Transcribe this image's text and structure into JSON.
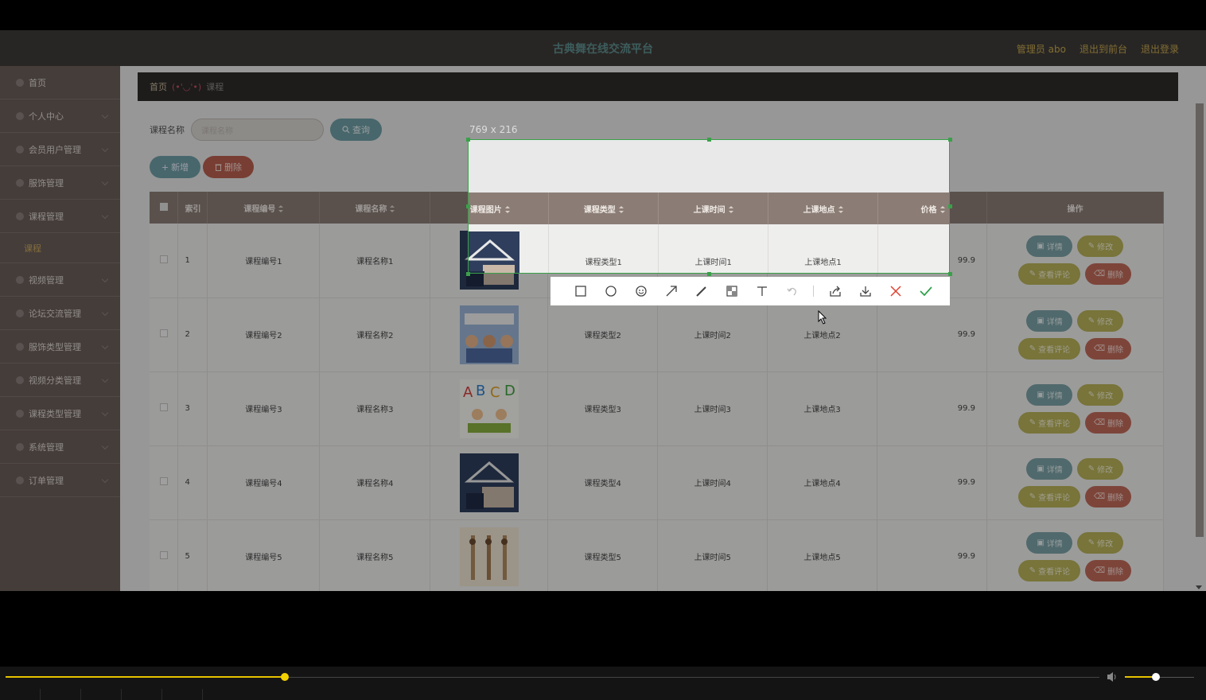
{
  "header": {
    "title": "古典舞在线交流平台",
    "links": [
      "管理员 abo",
      "退出到前台",
      "退出登录"
    ]
  },
  "sidebar": {
    "items": [
      {
        "label": "首页"
      },
      {
        "label": "个人中心"
      },
      {
        "label": "会员用户管理"
      },
      {
        "label": "服饰管理"
      },
      {
        "label": "课程管理"
      },
      {
        "label": "视频管理"
      },
      {
        "label": "论坛交流管理"
      },
      {
        "label": "服饰类型管理"
      },
      {
        "label": "视频分类管理"
      },
      {
        "label": "课程类型管理"
      },
      {
        "label": "系统管理"
      },
      {
        "label": "订单管理"
      }
    ],
    "sub_item": "课程"
  },
  "breadcrumb": {
    "home": "首页",
    "emoticon": "(•'◡'•)",
    "current": "课程"
  },
  "search": {
    "label": "课程名称",
    "placeholder": "课程名称",
    "query_button": "查询"
  },
  "actions": {
    "add": "新增",
    "delete": "删除"
  },
  "table": {
    "headers": [
      "索引",
      "课程编号",
      "课程名称",
      "课程图片",
      "课程类型",
      "上课时间",
      "上课地点",
      "价格",
      "操作"
    ],
    "rows": [
      {
        "index": "1",
        "code": "课程编号1",
        "name": "课程名称1",
        "type": "课程类型1",
        "time": "上课时间1",
        "place": "上课地点1",
        "price": "99.9"
      },
      {
        "index": "2",
        "code": "课程编号2",
        "name": "课程名称2",
        "type": "课程类型2",
        "time": "上课时间2",
        "place": "上课地点2",
        "price": "99.9"
      },
      {
        "index": "3",
        "code": "课程编号3",
        "name": "课程名称3",
        "type": "课程类型3",
        "time": "上课时间3",
        "place": "上课地点3",
        "price": "99.9"
      },
      {
        "index": "4",
        "code": "课程编号4",
        "name": "课程名称4",
        "type": "课程类型4",
        "time": "上课时间4",
        "place": "上课地点4",
        "price": "99.9"
      },
      {
        "index": "5",
        "code": "课程编号5",
        "name": "课程名称5",
        "type": "课程类型5",
        "time": "上课时间5",
        "place": "上课地点5",
        "price": "99.9"
      }
    ],
    "op_labels": {
      "detail": "详情",
      "edit": "修改",
      "comment": "查看评论",
      "delete": "删除"
    }
  },
  "capture": {
    "size_label": "769 x 216"
  },
  "player": {
    "progress": 0.255,
    "volume": 0.45
  },
  "colors": {
    "accent_teal": "#6f9ea6",
    "accent_olive": "#b9b35a",
    "danger": "#c16b5a",
    "capture_green": "#3aa04a"
  }
}
